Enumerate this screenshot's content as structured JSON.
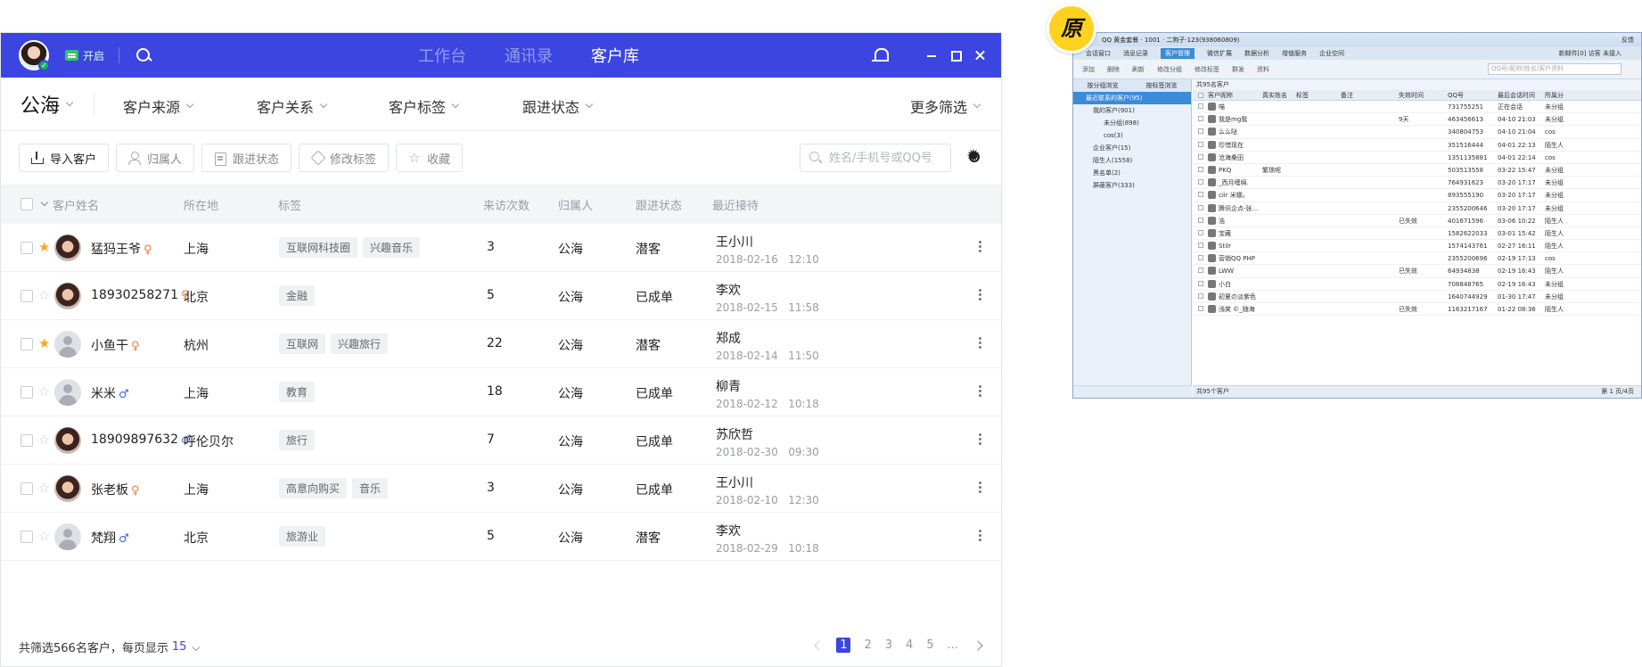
{
  "app": {
    "status_label": "开启",
    "tabs": [
      "工作台",
      "通讯录",
      "客户库"
    ],
    "active_tab_index": 2
  },
  "filters": {
    "pool": "公海",
    "items": [
      "客户来源",
      "客户关系",
      "客户标签",
      "跟进状态"
    ],
    "more": "更多筛选"
  },
  "actions": {
    "import": "导入客户",
    "assign": "归属人",
    "follow": "跟进状态",
    "edit_tag": "修改标签",
    "favorite": "收藏",
    "search_placeholder": "姓名/手机号或QQ号"
  },
  "table": {
    "columns": [
      "客户姓名",
      "所在地",
      "标签",
      "来访次数",
      "归属人",
      "跟进状态",
      "最近接待"
    ],
    "rows": [
      {
        "starred": true,
        "avatar": "photo",
        "name": "猛犸王爷",
        "gender": "♀",
        "location": "上海",
        "tags": [
          "互联网科技圈",
          "兴趣音乐"
        ],
        "visits": "3",
        "owner": "公海",
        "status": "潜客",
        "recv_name": "王小川",
        "recv_date": "2018-02-16",
        "recv_time": "12:10"
      },
      {
        "starred": false,
        "avatar": "photo",
        "name": "18930258271",
        "gender": "♀",
        "location": "北京",
        "tags": [
          "金融"
        ],
        "visits": "5",
        "owner": "公海",
        "status": "已成单",
        "recv_name": "李欢",
        "recv_date": "2018-02-15",
        "recv_time": "11:58"
      },
      {
        "starred": true,
        "avatar": "default",
        "name": "小鱼干",
        "gender": "♀",
        "location": "杭州",
        "tags": [
          "互联网",
          "兴趣旅行"
        ],
        "visits": "22",
        "owner": "公海",
        "status": "潜客",
        "recv_name": "郑成",
        "recv_date": "2018-02-14",
        "recv_time": "11:50"
      },
      {
        "starred": false,
        "avatar": "default",
        "name": "米米",
        "gender": "♂",
        "location": "上海",
        "tags": [
          "教育"
        ],
        "visits": "18",
        "owner": "公海",
        "status": "已成单",
        "recv_name": "柳青",
        "recv_date": "2018-02-12",
        "recv_time": "10:18"
      },
      {
        "starred": false,
        "avatar": "photo",
        "name": "18909897632",
        "gender": "♂",
        "location": "呼伦贝尔",
        "tags": [
          "旅行"
        ],
        "visits": "7",
        "owner": "公海",
        "status": "已成单",
        "recv_name": "苏欣哲",
        "recv_date": "2018-02-30",
        "recv_time": "09:30"
      },
      {
        "starred": false,
        "avatar": "photo",
        "name": "张老板",
        "gender": "♀",
        "location": "上海",
        "tags": [
          "高意向购买",
          "音乐"
        ],
        "visits": "3",
        "owner": "公海",
        "status": "已成单",
        "recv_name": "王小川",
        "recv_date": "2018-02-10",
        "recv_time": "12:30"
      },
      {
        "starred": false,
        "avatar": "default",
        "name": "梵翔",
        "gender": "♂",
        "location": "北京",
        "tags": [
          "旅游业"
        ],
        "visits": "5",
        "owner": "公海",
        "status": "潜客",
        "recv_name": "李欢",
        "recv_date": "2018-02-29",
        "recv_time": "10:18"
      }
    ]
  },
  "footer": {
    "summary": "共筛选566名客户，每页显示",
    "page_size": "15",
    "pages": [
      "1",
      "2",
      "3",
      "4",
      "5",
      "..."
    ],
    "current_page": "1"
  },
  "colors": {
    "accent": "#3b46e0",
    "star_on": "#f5a623",
    "female": "#f07a3a",
    "male": "#3b63e0"
  },
  "original": {
    "badge": "原",
    "title": "QQ 黄金套餐 · 1001 · 二狗子·123(938060809)",
    "title_right": "反馈",
    "menu": [
      "会话窗口",
      "消息记录",
      "客户管理",
      "微信扩展",
      "数据分析",
      "增值服务",
      "企业空间"
    ],
    "menu_active": 2,
    "menu_right": "新邮件[0]  访客  未接入",
    "toolbar": [
      "添加",
      "删除",
      "刷新",
      "修改分组",
      "修改标签",
      "群发",
      "资料"
    ],
    "search_placeholder": "QQ号/昵称/姓名/客户资料",
    "left_tabs": [
      "按分组浏览",
      "按标签浏览"
    ],
    "tree": [
      {
        "label": "最近联系的客户(95)",
        "level": 1,
        "selected": true
      },
      {
        "label": "我的客户(901)",
        "level": 2,
        "selected": false
      },
      {
        "label": "未分组(898)",
        "level": 3,
        "selected": false
      },
      {
        "label": "cos(3)",
        "level": 3,
        "selected": false
      },
      {
        "label": "企业客户(15)",
        "level": 2,
        "selected": false
      },
      {
        "label": "陌生人(1558)",
        "level": 2,
        "selected": false
      },
      {
        "label": "黑名单(2)",
        "level": 2,
        "selected": false
      },
      {
        "label": "屏蔽客户(333)",
        "level": 2,
        "selected": false
      }
    ],
    "caption": "共95名客户",
    "columns": [
      "客户昵称",
      "真实姓名",
      "标签",
      "备注",
      "失效时间",
      "QQ号",
      "最后会话时间",
      "所属分"
    ],
    "rows": [
      [
        "喵",
        "",
        "",
        "",
        "",
        "731755251",
        "正在会话",
        "未分组"
      ],
      [
        "我是mg我",
        "",
        "",
        "",
        "9天",
        "463456613",
        "04-10 21:03",
        "未分组"
      ],
      [
        "么么哒",
        "",
        "",
        "",
        "",
        "340804753",
        "04-10 21:04",
        "cos"
      ],
      [
        "珍惜现在",
        "",
        "",
        "",
        "",
        "351516444",
        "04-01 22:13",
        "陌生人"
      ],
      [
        "沧海桑田",
        "",
        "",
        "",
        "",
        "1351135881",
        "04-01 22:14",
        "cos"
      ],
      [
        "PKQ",
        "繁琐呢",
        "",
        "",
        "",
        "503513558",
        "03-22 15:47",
        "未分组"
      ],
      [
        "_西月缠绵.",
        "",
        "",
        "",
        "",
        "764931623",
        "03-20 17:17",
        "未分组"
      ],
      [
        "ciir 米娜。",
        "",
        "",
        "",
        "",
        "893555190",
        "03-20 17:17",
        "未分组"
      ],
      [
        "腾讯企点-张...",
        "",
        "",
        "",
        "",
        "2355200646",
        "03-20 17:17",
        "未分组"
      ],
      [
        "浩",
        "",
        "",
        "",
        "已失效",
        "401671596",
        "03-06 10:22",
        "陌生人"
      ],
      [
        "宝藏",
        "",
        "",
        "",
        "",
        "1582622033",
        "03-01 15:42",
        "陌生人"
      ],
      [
        "Stilr",
        "",
        "",
        "",
        "",
        "1574143761",
        "02-27 16:11",
        "陌生人"
      ],
      [
        "营销QQ PHP",
        "",
        "",
        "",
        "",
        "2355200696",
        "02-19 17:13",
        "cos"
      ],
      [
        "LWW",
        "",
        "",
        "",
        "已失效",
        "64934838",
        "02-19 16:43",
        "陌生人"
      ],
      [
        "小白",
        "",
        "",
        "",
        "",
        "708848765",
        "02-19 16:43",
        "未分组"
      ],
      [
        "初夏の淡紫色",
        "",
        "",
        "",
        "",
        "1640744929",
        "01-30 17:47",
        "未分组"
      ],
      [
        "浅笑 ©_随海",
        "",
        "",
        "",
        "已失效",
        "1163217167",
        "01-22 08:36",
        "陌生人"
      ]
    ],
    "footer_left": "共95个客户",
    "footer_right": "第 1 页/4页"
  }
}
